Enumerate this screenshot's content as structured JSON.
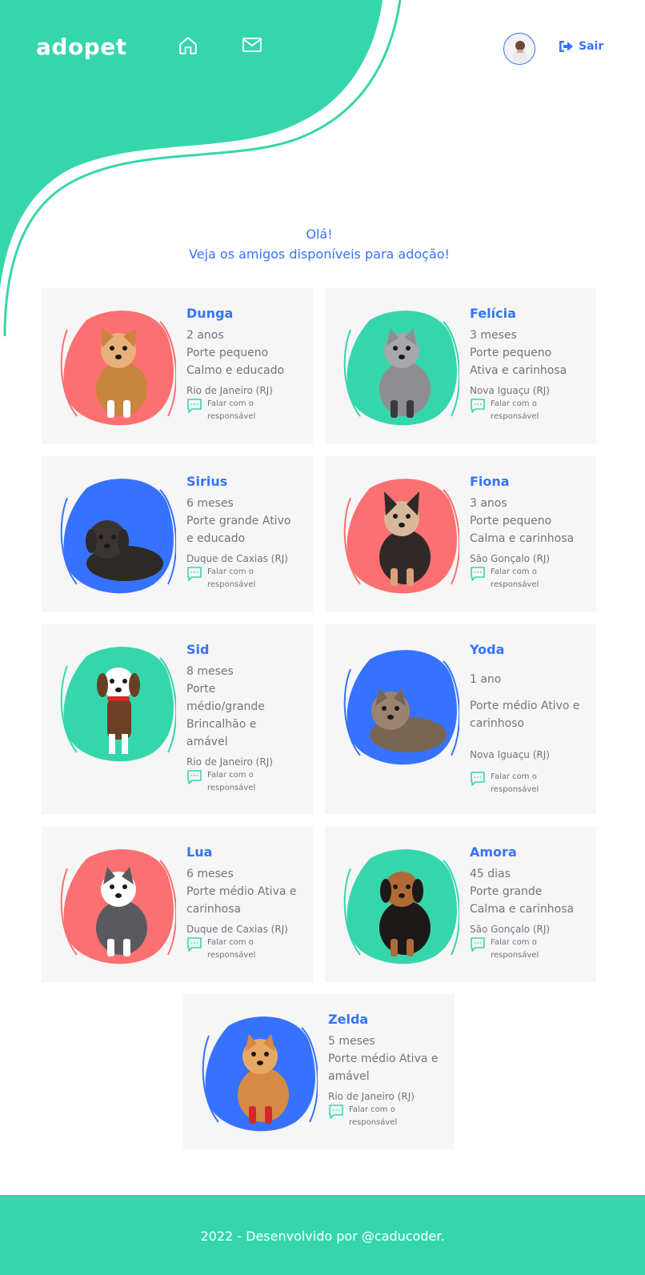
{
  "header": {
    "logo": "adopet",
    "nav": {
      "home_icon": "home-icon",
      "messages_icon": "mail-icon"
    },
    "avatar_alt": "avatar",
    "logout_label": "Sair",
    "logout_icon": "logout-icon"
  },
  "intro": {
    "greeting": "Olá!",
    "subtitle": "Veja os amigos disponíveis para adoção!"
  },
  "contact_label": "Falar com o responsável",
  "colors": {
    "green": "#36D6AD",
    "blue": "#3772FF",
    "red": "#FC7071",
    "card": "#F6F6F6"
  },
  "pets": [
    {
      "name": "Dunga",
      "age": "2 anos",
      "desc1": "Porte pequeno",
      "desc2": "Calmo e educado",
      "city": "Rio de Janeiro (RJ)",
      "blob": "red",
      "animal": "corgi"
    },
    {
      "name": "Felícia",
      "age": "3 meses",
      "desc1": "Porte pequeno",
      "desc2": "Ativa e carinhosa",
      "city": "Nova Iguaçu (RJ)",
      "blob": "green",
      "animal": "tabby-cat"
    },
    {
      "name": "Sirius",
      "age": "6 meses",
      "desc1": "Porte grande Ativo",
      "desc2": "e educado",
      "city": "Duque de Caxias (RJ)",
      "blob": "blue",
      "animal": "black-dog"
    },
    {
      "name": "Fiona",
      "age": "3 anos",
      "desc1": "Porte pequeno",
      "desc2": "Calma e carinhosa",
      "city": "São Gonçalo (RJ)",
      "blob": "red",
      "animal": "chihuahua"
    },
    {
      "name": "Sid",
      "age": "8 meses",
      "desc1": "Porte",
      "desc2": "médio/grande",
      "desc3": "Brincalhão e",
      "desc4": "amável",
      "city": "Rio de Janeiro (RJ)",
      "blob": "green",
      "animal": "mixed-dog"
    },
    {
      "name": "Yoda",
      "age": "1 ano",
      "desc1": "Porte médio Ativo e",
      "desc2": "carinhoso",
      "city": "Nova Iguaçu (RJ)",
      "blob": "blue",
      "animal": "lying-cat"
    },
    {
      "name": "Lua",
      "age": "6 meses",
      "desc1": "Porte médio Ativa e",
      "desc2": "carinhosa",
      "city": "Duque de Caxias (RJ)",
      "blob": "red",
      "animal": "grey-cat"
    },
    {
      "name": "Amora",
      "age": "45 dias",
      "desc1": "Porte grande",
      "desc2": "Calma e carinhosa",
      "city": "São Gonçalo (RJ)",
      "blob": "green",
      "animal": "puppy"
    },
    {
      "name": "Zelda",
      "age": "5 meses",
      "desc1": "Porte médio Ativa e",
      "desc2": "amável",
      "city": "Rio de Janeiro (RJ)",
      "blob": "blue",
      "animal": "orange-cat"
    }
  ],
  "footer": {
    "text": "2022 - Desenvolvido por @caducoder."
  }
}
